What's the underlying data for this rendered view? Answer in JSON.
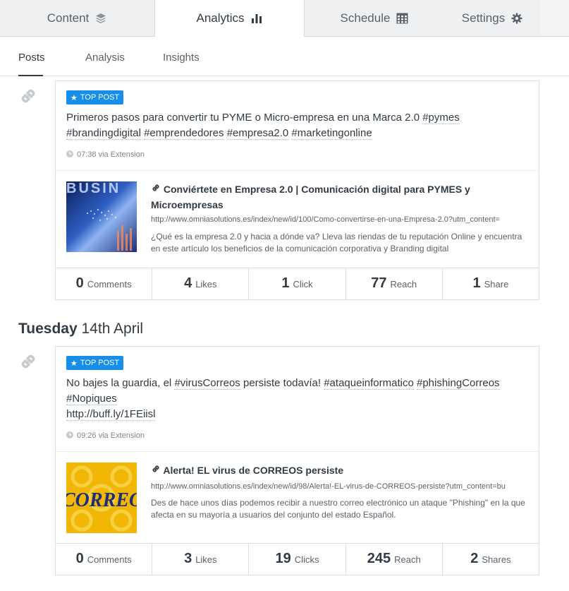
{
  "top_tabs": [
    {
      "label": "Content",
      "icon": "layers-icon"
    },
    {
      "label": "Analytics",
      "icon": "bar-chart-icon"
    },
    {
      "label": "Schedule",
      "icon": "calendar-icon"
    },
    {
      "label": "Settings",
      "icon": "gear-icon"
    }
  ],
  "sub_tabs": [
    "Posts",
    "Analysis",
    "Insights"
  ],
  "date_header": {
    "day": "Tuesday",
    "date": "14th April"
  },
  "colors": {
    "accent": "#168eea",
    "text": "#323b43",
    "muted": "#59626a"
  },
  "posts": [
    {
      "badge": "TOP POST",
      "text_parts": [
        "Primeros pasos para convertir tu PYME o Micro-empresa en una Marca 2.0 ",
        "#pymes",
        "#brandingdigital",
        "#emprendedores",
        "#empresa2.0",
        "#marketingonline"
      ],
      "meta": "07:38 via Extension",
      "preview": {
        "title": "Conviértete en Empresa 2.0 | Comunicación digital para PYMES y Microempresas",
        "url": "http://www.omniasolutions.es/index/new/id/100/Como-convertirse-en-una-Empresa-2.0?utm_content=",
        "description": "¿Qué es la empresa 2.0 y hacia a dónde va? Lleva las riendas de tu reputación Online y encuentra en este artículo los beneficios de la comunicación corporativa y Branding digital"
      },
      "stats": [
        {
          "num": "0",
          "label": "Comments"
        },
        {
          "num": "4",
          "label": "Likes"
        },
        {
          "num": "1",
          "label": "Click"
        },
        {
          "num": "77",
          "label": "Reach"
        },
        {
          "num": "1",
          "label": "Share"
        }
      ]
    },
    {
      "badge": "TOP POST",
      "text_parts": [
        "No bajes la guardia, el ",
        "#virusCorreos",
        " persiste todavía! ",
        "#ataqueinformatico",
        "#phishingCorreos",
        "#Nopiques",
        "http://buff.ly/1FEiisl"
      ],
      "meta": "09:26 via Extension",
      "preview": {
        "title": "Alerta! EL virus de CORREOS persiste",
        "url": "http://www.omniasolutions.es/index/new/id/98/Alerta!-EL-virus-de-CORREOS-persiste?utm_content=bu",
        "description": "Des de hace unos días podemos recibir a nuestro correo electrónico un ataque   \"Phishing\" en la que afecta en su mayoría a usuarios del conjunto del estado Español.",
        "image_text": "CORREOS"
      },
      "stats": [
        {
          "num": "0",
          "label": "Comments"
        },
        {
          "num": "3",
          "label": "Likes"
        },
        {
          "num": "19",
          "label": "Clicks"
        },
        {
          "num": "245",
          "label": "Reach"
        },
        {
          "num": "2",
          "label": "Shares"
        }
      ]
    }
  ]
}
